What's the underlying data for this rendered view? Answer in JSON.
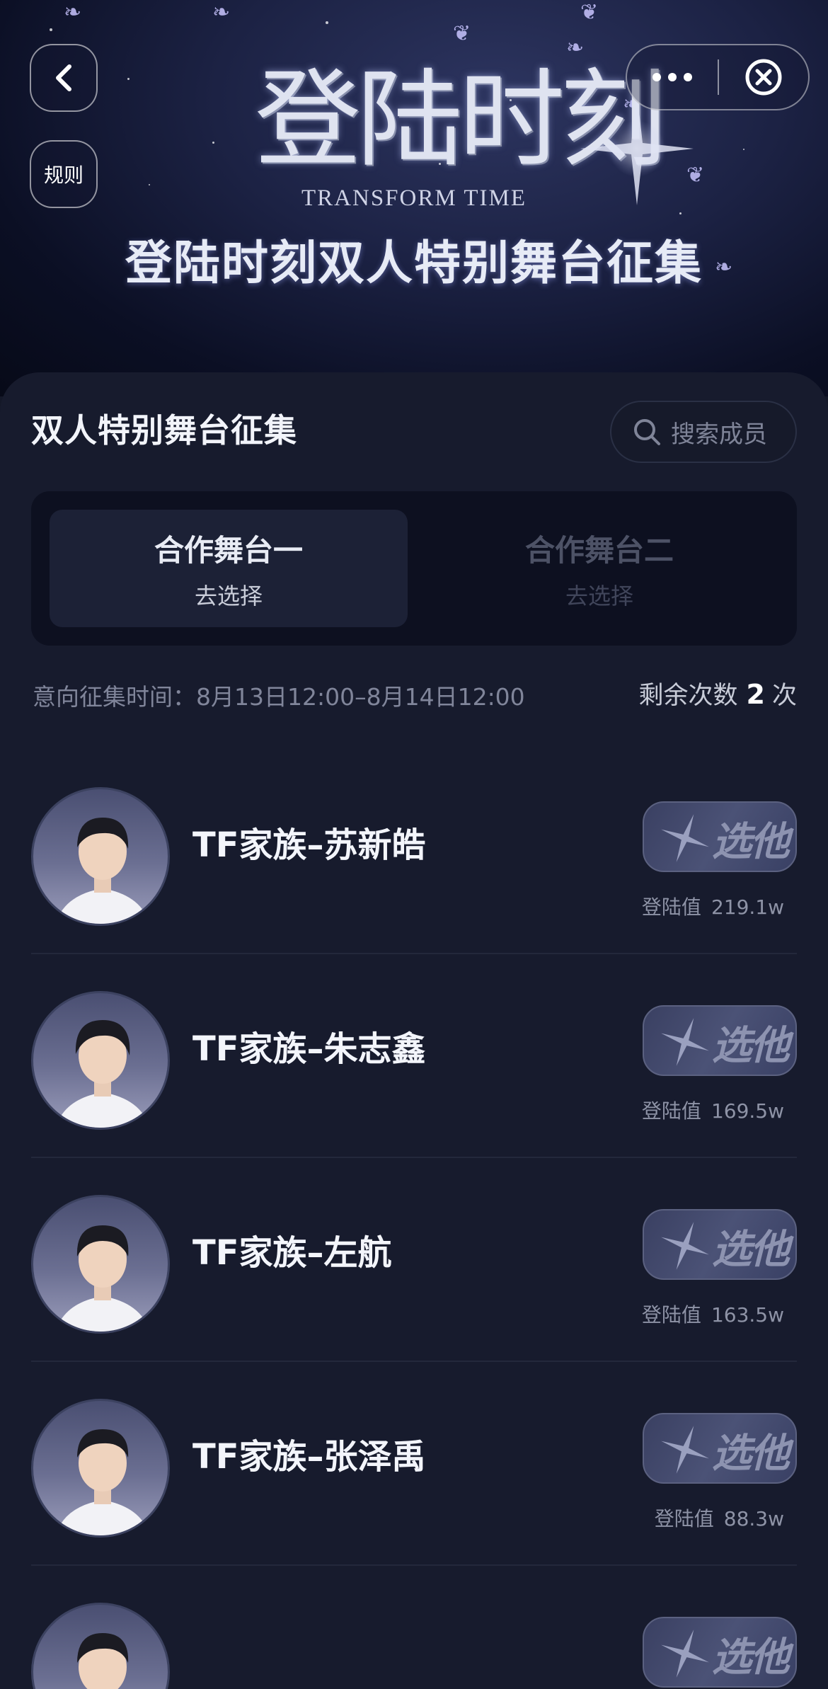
{
  "header": {
    "logo_title": "登陆时刻",
    "logo_subtitle": "TRANSFORM TIME",
    "heading": "登陆时刻双人特别舞台征集",
    "rules_label": "规则",
    "back_icon": "chevron-left-icon",
    "more_icon": "more-dots-icon",
    "close_icon": "close-circle-icon"
  },
  "panel": {
    "title": "双人特别舞台征集",
    "search_placeholder": "搜索成员"
  },
  "tabs": [
    {
      "label": "合作舞台一",
      "sub": "去选择",
      "active": true
    },
    {
      "label": "合作舞台二",
      "sub": "去选择",
      "active": false
    }
  ],
  "period": "意向征集时间：8月13日12:00–8月14日12:00",
  "remain": {
    "label": "剩余次数",
    "count": "2",
    "unit": "次"
  },
  "members": [
    {
      "name": "TF家族–苏新皓",
      "button": "选他",
      "score_label": "登陆值",
      "score": "219.1w"
    },
    {
      "name": "TF家族–朱志鑫",
      "button": "选他",
      "score_label": "登陆值",
      "score": "169.5w"
    },
    {
      "name": "TF家族–左航",
      "button": "选他",
      "score_label": "登陆值",
      "score": "163.5w"
    },
    {
      "name": "TF家族–张泽禹",
      "button": "选他",
      "score_label": "登陆值",
      "score": "88.3w"
    },
    {
      "name": "",
      "button": "选他",
      "score_label": "",
      "score": ""
    }
  ],
  "colors": {
    "background": "#141828",
    "panel": "#171b2d",
    "tab_container": "#0d1020",
    "tab_active": "#1c2136"
  }
}
